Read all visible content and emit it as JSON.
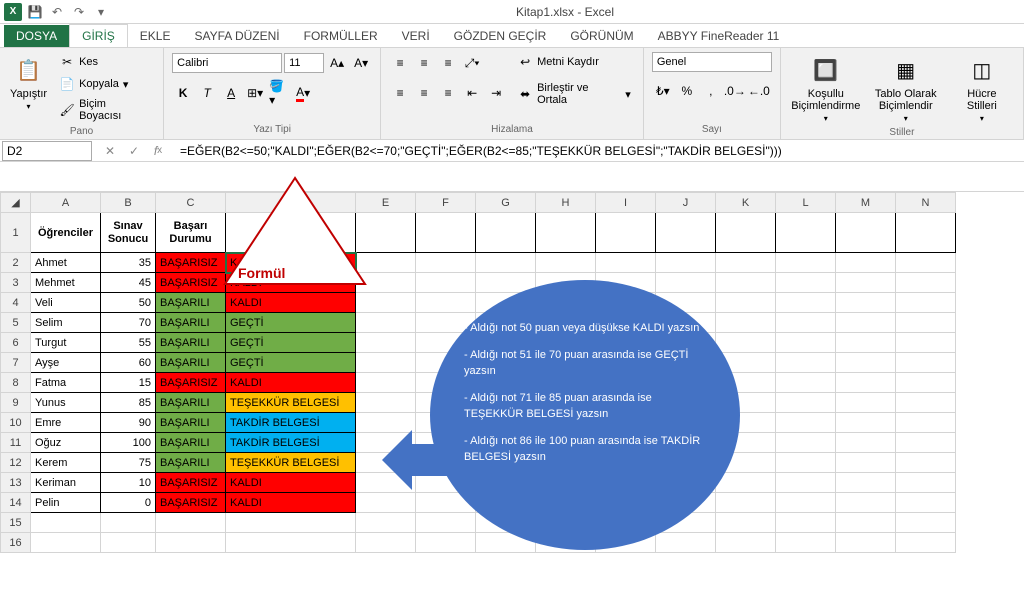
{
  "app": {
    "title": "Kitap1.xlsx - Excel"
  },
  "tabs": {
    "file": "DOSYA",
    "home": "GİRİŞ",
    "insert": "EKLE",
    "layout": "SAYFA DÜZENİ",
    "formulas": "FORMÜLLER",
    "data": "VERİ",
    "review": "GÖZDEN GEÇİR",
    "view": "GÖRÜNÜM",
    "abbyy": "ABBYY FineReader 11"
  },
  "ribbon": {
    "paste": "Yapıştır",
    "cut": "Kes",
    "copy": "Kopyala",
    "formatPainter": "Biçim Boyacısı",
    "panoGroup": "Pano",
    "font": "Calibri",
    "fontSize": "11",
    "fontGroup": "Yazı Tipi",
    "wrapText": "Metni Kaydır",
    "mergeCenter": "Birleştir ve Ortala",
    "alignGroup": "Hizalama",
    "numberFmt": "Genel",
    "numberGroup": "Sayı",
    "condFmt": "Koşullu Biçimlendirme",
    "fmtTable": "Tablo Olarak Biçimlendir",
    "cellStyles": "Hücre Stilleri",
    "stylesGroup": "Stiller"
  },
  "formulaBar": {
    "cellRef": "D2",
    "formula": "=EĞER(B2<=50;\"KALDI\";EĞER(B2<=70;\"GEÇTİ\";EĞER(B2<=85;\"TEŞEKKÜR BELGESİ\";\"TAKDİR BELGESİ\")))"
  },
  "headers": {
    "A": "Öğrenciler",
    "B": "Sınav Sonucu",
    "C": "Başarı Durumu",
    "D": "Formül"
  },
  "rows": [
    {
      "r": 2,
      "name": "Ahmet",
      "score": 35,
      "status": "BAŞARISIZ",
      "result": "KALDI",
      "sc": "basarisiz",
      "rc": "kaldi"
    },
    {
      "r": 3,
      "name": "Mehmet",
      "score": 45,
      "status": "BAŞARISIZ",
      "result": "KALDI",
      "sc": "basarisiz",
      "rc": "kaldi"
    },
    {
      "r": 4,
      "name": "Veli",
      "score": 50,
      "status": "BAŞARILI",
      "result": "KALDI",
      "sc": "basarili",
      "rc": "kaldi"
    },
    {
      "r": 5,
      "name": "Selim",
      "score": 70,
      "status": "BAŞARILI",
      "result": "GEÇTİ",
      "sc": "basarili",
      "rc": "gecti"
    },
    {
      "r": 6,
      "name": "Turgut",
      "score": 55,
      "status": "BAŞARILI",
      "result": "GEÇTİ",
      "sc": "basarili",
      "rc": "gecti"
    },
    {
      "r": 7,
      "name": "Ayşe",
      "score": 60,
      "status": "BAŞARILI",
      "result": "GEÇTİ",
      "sc": "basarili",
      "rc": "gecti"
    },
    {
      "r": 8,
      "name": "Fatma",
      "score": 15,
      "status": "BAŞARISIZ",
      "result": "KALDI",
      "sc": "basarisiz",
      "rc": "kaldi"
    },
    {
      "r": 9,
      "name": "Yunus",
      "score": 85,
      "status": "BAŞARILI",
      "result": "TEŞEKKÜR BELGESİ",
      "sc": "basarili",
      "rc": "tesekkur"
    },
    {
      "r": 10,
      "name": "Emre",
      "score": 90,
      "status": "BAŞARILI",
      "result": "TAKDİR BELGESİ",
      "sc": "basarili",
      "rc": "takdir"
    },
    {
      "r": 11,
      "name": "Oğuz",
      "score": 100,
      "status": "BAŞARILI",
      "result": "TAKDİR BELGESİ",
      "sc": "basarili",
      "rc": "takdir"
    },
    {
      "r": 12,
      "name": "Kerem",
      "score": 75,
      "status": "BAŞARILI",
      "result": "TEŞEKKÜR BELGESİ",
      "sc": "basarili",
      "rc": "tesekkur"
    },
    {
      "r": 13,
      "name": "Keriman",
      "score": 10,
      "status": "BAŞARISIZ",
      "result": "KALDI",
      "sc": "basarisiz",
      "rc": "kaldi"
    },
    {
      "r": 14,
      "name": "Pelin",
      "score": 0,
      "status": "BAŞARISIZ",
      "result": "KALDI",
      "sc": "basarisiz",
      "rc": "kaldi"
    }
  ],
  "columns": [
    "A",
    "B",
    "C",
    "D",
    "E",
    "F",
    "G",
    "H",
    "I",
    "J",
    "K",
    "L",
    "M",
    "N"
  ],
  "callout": {
    "l1": "- Aldığı not 50 puan veya düşükse KALDI yazsın",
    "l2": "- Aldığı not 51 ile 70 puan arasında ise GEÇTİ yazsın",
    "l3": "- Aldığı not 71 ile 85 puan arasında ise TEŞEKKÜR BELGESİ yazsın",
    "l4": "- Aldığı not 86 ile 100 puan arasında ise TAKDİR BELGESİ yazsın"
  }
}
